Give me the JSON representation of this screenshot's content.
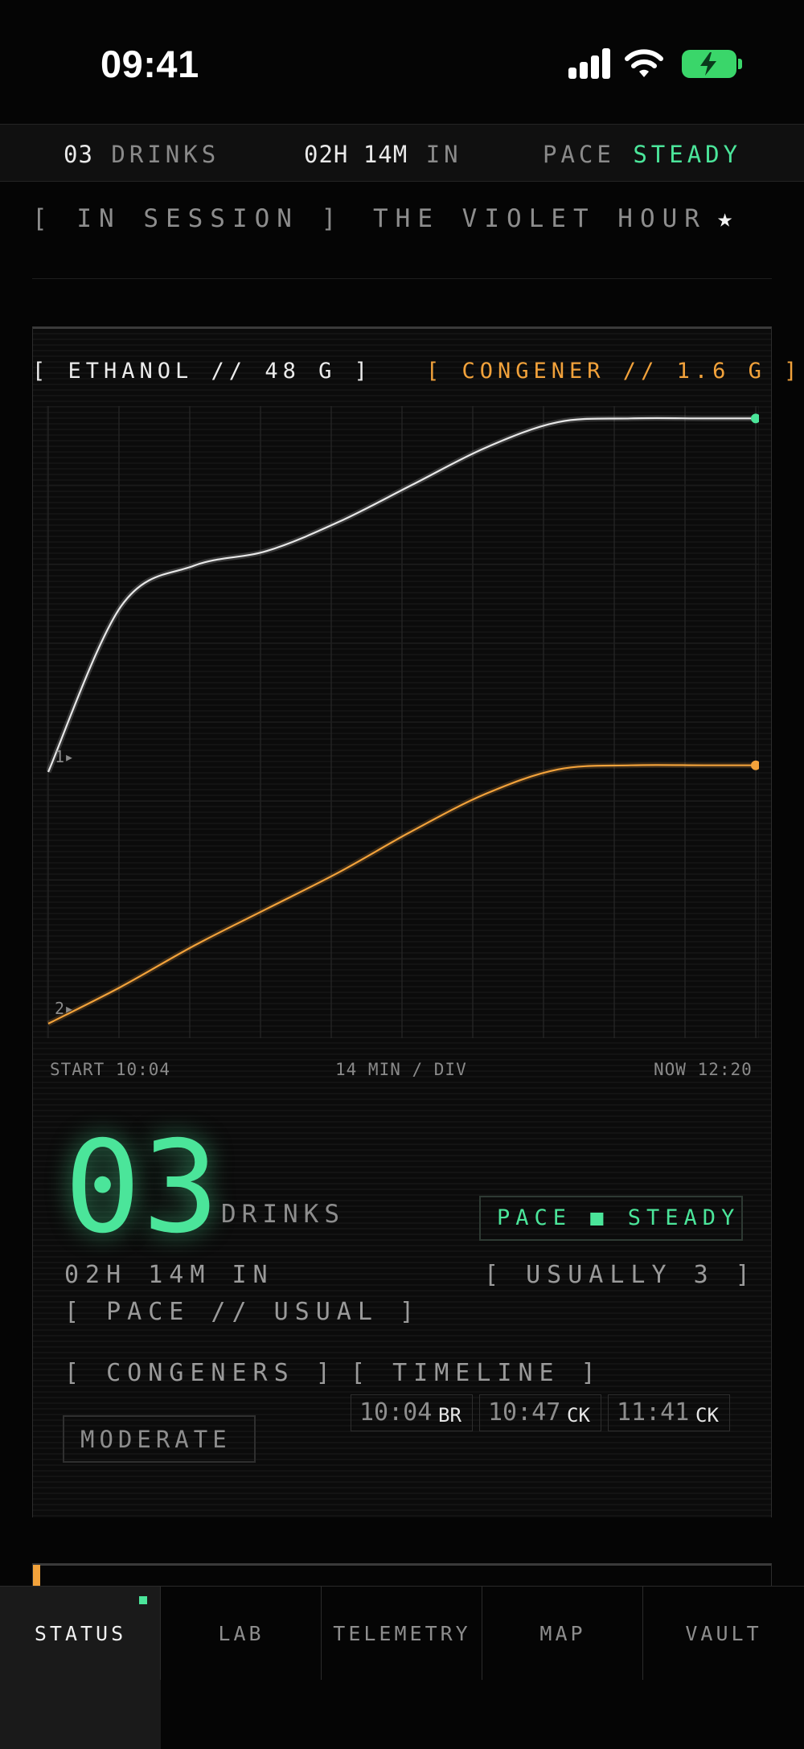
{
  "status_bar": {
    "time": "09:41"
  },
  "summary": {
    "drinks_count": "03",
    "drinks_label": "DRINKS",
    "elapsed": "02H 14M",
    "elapsed_suffix": "IN",
    "pace_label": "PACE",
    "pace_value": "STEADY"
  },
  "session": {
    "state": "[ IN SESSION ]",
    "venue": "THE VIOLET HOUR",
    "favorite_glyph": "★"
  },
  "readouts": {
    "ethanol": "[ ETHANOL // 48 G ]",
    "congener": "[ CONGENER // 1.6 G ]"
  },
  "chart_data": {
    "type": "line",
    "x_unit": "min",
    "xlim": [
      0,
      136
    ],
    "series": [
      {
        "color": "#e8e8e8",
        "marker_label": "1▸",
        "end_marker_color": "#4be59a",
        "x": [
          0,
          14,
          28,
          42,
          56,
          70,
          84,
          98,
          112,
          126,
          136
        ],
        "y": [
          0.0,
          0.45,
          0.56,
          0.6,
          0.68,
          0.78,
          0.88,
          0.95,
          0.96,
          0.96,
          0.96
        ]
      },
      {
        "color": "#f2a23b",
        "marker_label": "2▸",
        "end_marker_color": "#f2a23b",
        "x": [
          0,
          14,
          28,
          42,
          56,
          70,
          84,
          98,
          112,
          126,
          136
        ],
        "y": [
          0.0,
          0.09,
          0.19,
          0.28,
          0.37,
          0.47,
          0.56,
          0.62,
          0.63,
          0.63,
          0.63
        ]
      }
    ],
    "x_start_label": "START 10:04",
    "division_label": "14 MIN / DIV",
    "x_end_label": "NOW 12:20",
    "grid": true
  },
  "stats": {
    "count": "03",
    "count_unit": "DRINKS",
    "pace_badge": "PACE ■ STEADY",
    "elapsed_line": "02H 14M IN",
    "usual": "[ USUALLY 3 ]",
    "pace_compare": "[ PACE // USUAL ]"
  },
  "sections": {
    "congeners_tab": "[ CONGENERS ]",
    "timeline_tab": "[ TIMELINE ]",
    "congener_level": "MODERATE"
  },
  "timeline": [
    {
      "time": "10:04",
      "code": "BR"
    },
    {
      "time": "10:47",
      "code": "CK"
    },
    {
      "time": "11:41",
      "code": "CK"
    }
  ],
  "progress": {
    "fraction": 0.01,
    "color": "#f2a23b"
  },
  "nav": [
    {
      "label": "STATUS",
      "active": true
    },
    {
      "label": "LAB",
      "active": false
    },
    {
      "label": "TELEMETRY",
      "active": false
    },
    {
      "label": "MAP",
      "active": false
    },
    {
      "label": "VAULT",
      "active": false
    }
  ]
}
